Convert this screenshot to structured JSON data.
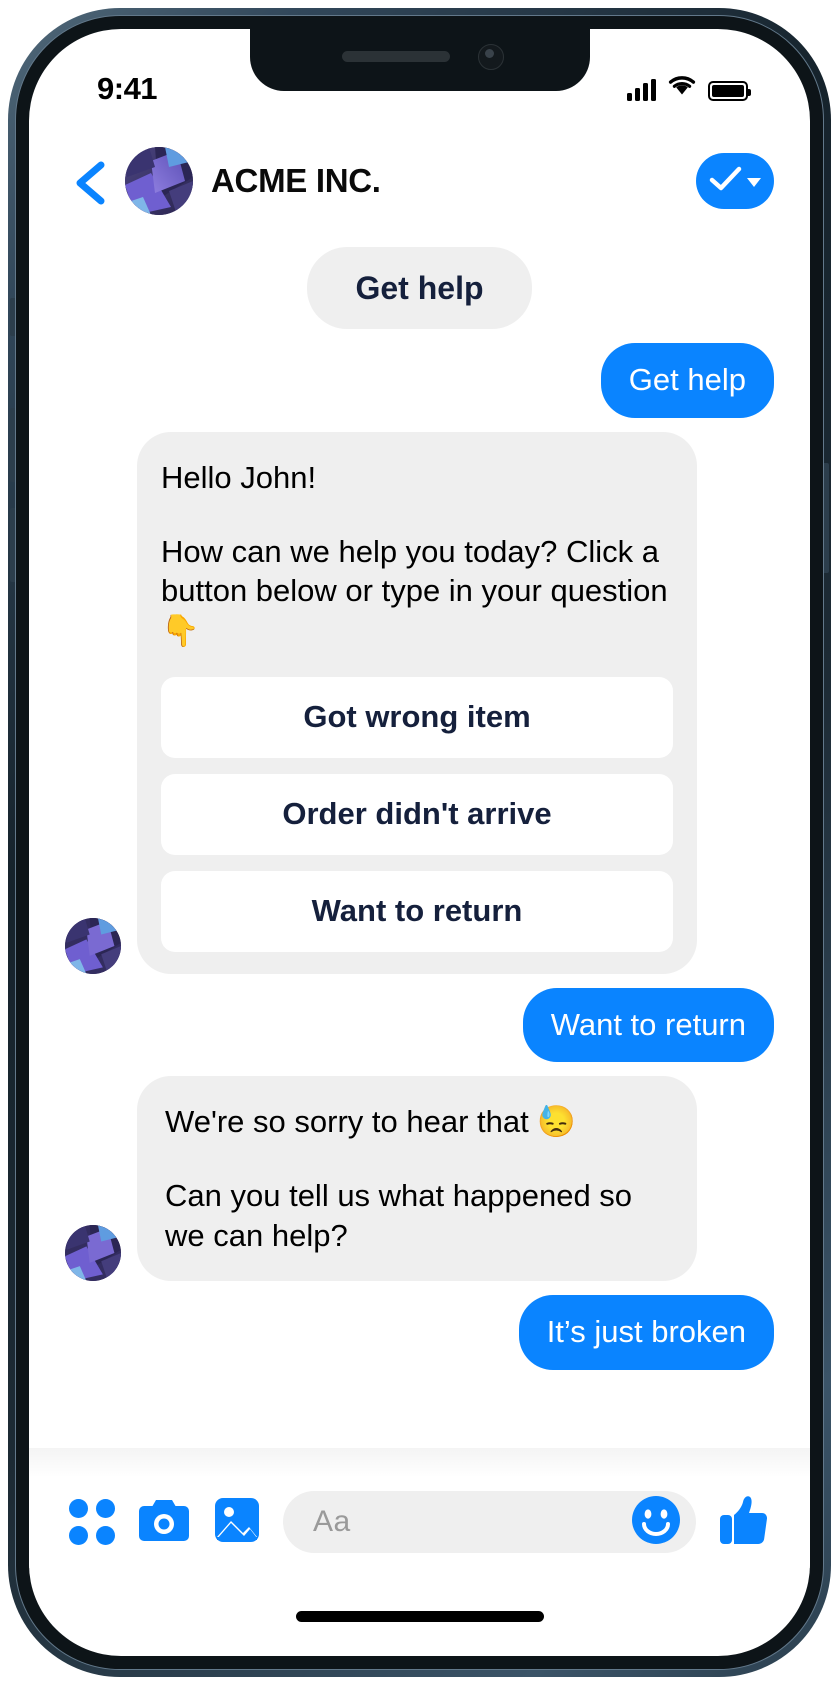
{
  "status_bar": {
    "time": "9:41",
    "signal_icon": "cellular-signal-icon",
    "wifi_icon": "wifi-icon",
    "battery_icon": "battery-icon"
  },
  "header": {
    "back_icon": "back-chevron-icon",
    "avatar_icon": "brand-avatar",
    "title": "ACME INC.",
    "verified_badge_icon": "checkmark-icon",
    "verified_dropdown_icon": "chevron-down-icon"
  },
  "thread": {
    "messages": [
      {
        "id": "m1",
        "kind": "pill",
        "align": "center",
        "text": "Get help"
      },
      {
        "id": "m2",
        "kind": "user",
        "align": "right",
        "text": "Get help"
      },
      {
        "id": "m3",
        "kind": "bot",
        "align": "left",
        "paragraphs": [
          "Hello John!",
          "How can we help you today? Click a button below or type in your question 👇"
        ],
        "quick_replies": [
          "Got wrong item",
          "Order didn't arrive",
          "Want to return"
        ]
      },
      {
        "id": "m4",
        "kind": "user",
        "align": "right",
        "text": "Want to return"
      },
      {
        "id": "m5",
        "kind": "bot",
        "align": "left",
        "paragraphs": [
          "We're so sorry to hear that 😓",
          "Can you tell us what happened so we can help?"
        ]
      },
      {
        "id": "m6",
        "kind": "user",
        "align": "right",
        "text": "It’s just broken"
      }
    ]
  },
  "composer": {
    "menu_icon": "four-dots-grid-icon",
    "camera_icon": "camera-icon",
    "gallery_icon": "photo-image-icon",
    "input_placeholder": "Aa",
    "emoji_icon": "smiley-face-icon",
    "like_icon": "thumbs-up-icon"
  },
  "colors": {
    "accent_blue": "#0a84ff",
    "bubble_grey": "#efefef",
    "navy_text": "#15203c",
    "bot_text": "#000000"
  }
}
